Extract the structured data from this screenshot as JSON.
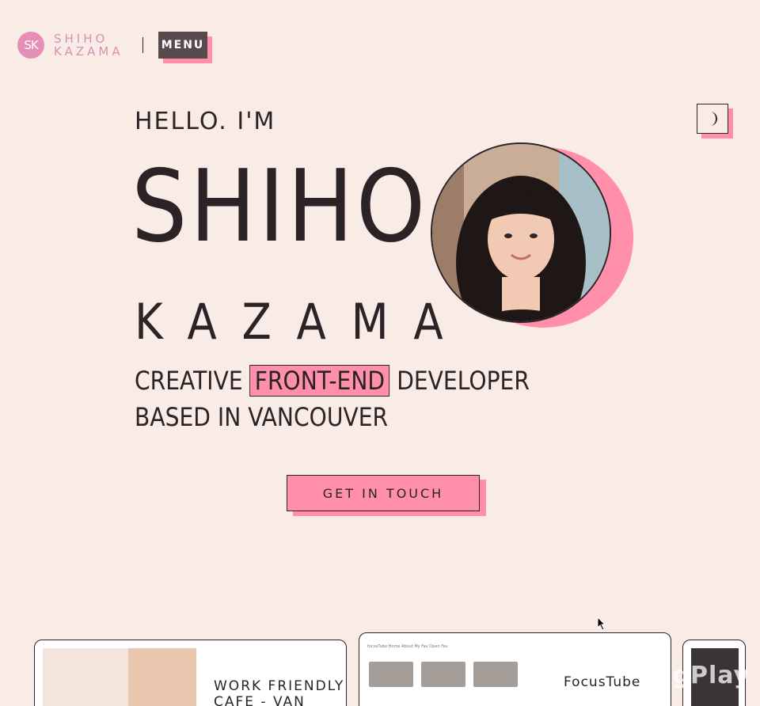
{
  "header": {
    "logo_mark": "SK",
    "logo_line1": "SHIHO",
    "logo_line2": "KAZAMA",
    "menu_label": "MENU"
  },
  "hero": {
    "greeting": "HELLO. I'M",
    "first_name": "SHIHO",
    "last_name": "KAZAMA",
    "tagline_pre": "CREATIVE",
    "tagline_highlight": "FRONT-END",
    "tagline_post": "DEVELOPER",
    "tagline_line2": "BASED IN VANCOUVER",
    "cta_label": "GET IN TOUCH"
  },
  "theme_toggle": {
    "icon": "moon-icon"
  },
  "projects": [
    {
      "title_line1": "WORK FRIENDLY",
      "title_line2": "CAFE - VAN"
    },
    {
      "title": "FocusTube",
      "nav_text": "focusTube   Home   About   My Fav   Open Fav"
    },
    {
      "title": ""
    }
  ],
  "watermark": "imgPlay",
  "colors": {
    "background": "#f9ece7",
    "accent_pink": "#ff8fab",
    "text": "#2b2326",
    "logo_pink": "#e58fb7",
    "menu_bg": "#574a4c"
  }
}
